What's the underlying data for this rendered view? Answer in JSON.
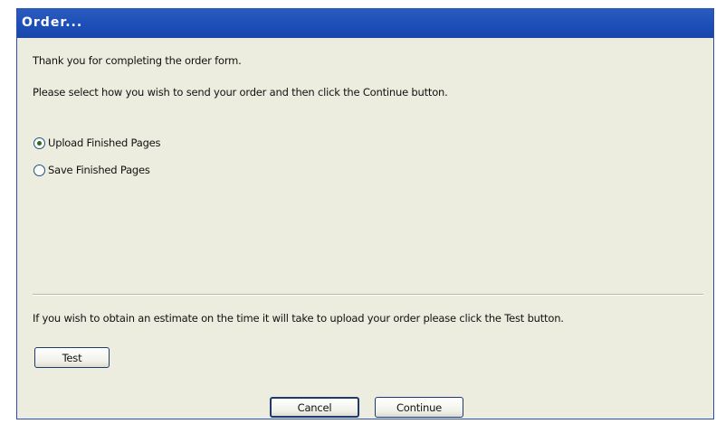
{
  "window": {
    "title": "Order..."
  },
  "intro": {
    "thanks": "Thank you for completing the order form.",
    "instruction": "Please select how you wish to send your order and then click the Continue button."
  },
  "options": [
    {
      "label": "Upload Finished Pages",
      "selected": true
    },
    {
      "label": "Save Finished Pages",
      "selected": false
    }
  ],
  "estimate": {
    "text": "If you wish to obtain an estimate on the time it will take to upload your order please click the Test button.",
    "test_label": "Test"
  },
  "footer": {
    "cancel_label": "Cancel",
    "continue_label": "Continue"
  }
}
